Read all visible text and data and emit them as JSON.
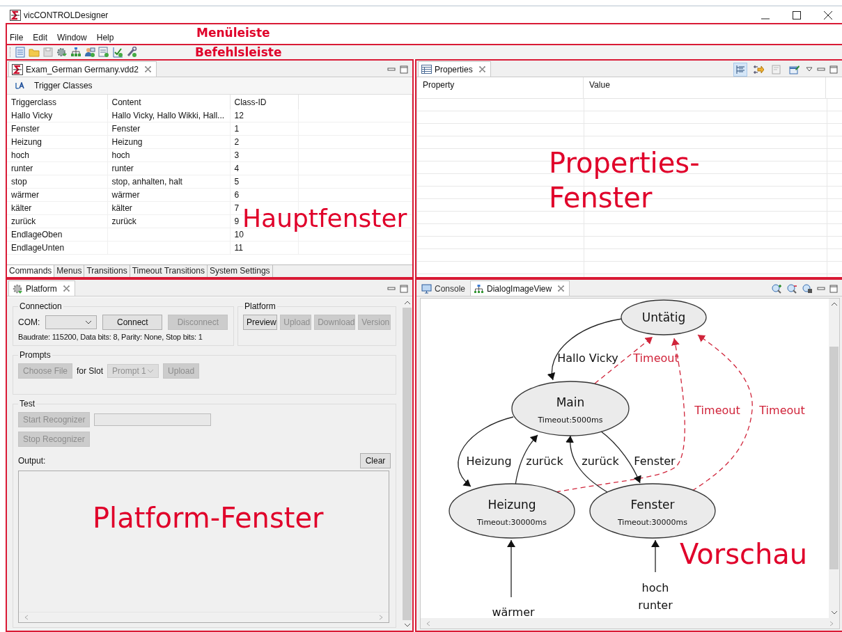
{
  "window": {
    "title": "vicCONTROLDesigner"
  },
  "menu": {
    "items": [
      "File",
      "Edit",
      "Window",
      "Help"
    ],
    "annotation": "Menüleiste"
  },
  "toolbar": {
    "annotation": "Befehlsleiste"
  },
  "editor": {
    "tab": "Exam_German Germany.vdd2",
    "heading": "Trigger Classes",
    "columns": [
      "Triggerclass",
      "Content",
      "Class-ID"
    ],
    "rows": [
      {
        "triggerclass": "Hallo Vicky",
        "content": "Hallo Vicky, Hallo Wikki, Hall...",
        "class_id": "12"
      },
      {
        "triggerclass": "Fenster",
        "content": "Fenster",
        "class_id": "1"
      },
      {
        "triggerclass": "Heizung",
        "content": "Heizung",
        "class_id": "2"
      },
      {
        "triggerclass": "hoch",
        "content": "hoch",
        "class_id": "3"
      },
      {
        "triggerclass": "runter",
        "content": "runter",
        "class_id": "4"
      },
      {
        "triggerclass": "stop",
        "content": "stop, anhalten, halt",
        "class_id": "5"
      },
      {
        "triggerclass": "wärmer",
        "content": "wärmer",
        "class_id": "6"
      },
      {
        "triggerclass": "kälter",
        "content": "kälter",
        "class_id": "7"
      },
      {
        "triggerclass": "zurück",
        "content": "zurück",
        "class_id": "9"
      },
      {
        "triggerclass": "EndlageOben",
        "class_id": "10"
      },
      {
        "triggerclass": "EndlageUnten",
        "class_id": "11"
      }
    ],
    "tabs": [
      {
        "label": "Commands",
        "selected": true
      },
      {
        "label": "Menus",
        "selected": false
      },
      {
        "label": "Transitions",
        "selected": false
      },
      {
        "label": "Timeout Transitions",
        "selected": false
      },
      {
        "label": "System Settings",
        "selected": false
      }
    ],
    "annotation": "Hauptfenster"
  },
  "properties": {
    "tab": "Properties",
    "columns": [
      "Property",
      "Value"
    ],
    "annotation": "Properties-Fenster"
  },
  "platform": {
    "tab": "Platform",
    "connection": {
      "legend": "Connection",
      "com_label": "COM:",
      "buttons": [
        {
          "label": "Connect",
          "disabled": false
        },
        {
          "label": "Disconnect",
          "disabled": true
        }
      ],
      "info": "Baudrate: 115200, Data bits: 8, Parity: None, Stop bits: 1"
    },
    "platform_group": {
      "legend": "Platform",
      "buttons": [
        {
          "label": "Preview",
          "disabled": false
        },
        {
          "label": "Upload",
          "disabled": true
        },
        {
          "label": "Download",
          "disabled": true
        },
        {
          "label": "Version",
          "disabled": true
        }
      ]
    },
    "prompts": {
      "legend": "Prompts",
      "choose": {
        "label": "Choose File",
        "disabled": true
      },
      "for_slot": "for Slot",
      "slot": {
        "value": "Prompt 1",
        "disabled": true
      },
      "upload": {
        "label": "Upload",
        "disabled": true
      }
    },
    "test": {
      "legend": "Test",
      "buttons": [
        {
          "label": "Start Recognizer",
          "disabled": true
        },
        {
          "label": "Stop Recognizer",
          "disabled": true
        }
      ],
      "output_label": "Output:",
      "clear": {
        "label": "Clear",
        "disabled": false
      }
    },
    "annotation": "Platform-Fenster"
  },
  "preview": {
    "tabs": [
      {
        "label": "Console",
        "selected": false
      },
      {
        "label": "DialogImageView",
        "selected": true
      }
    ],
    "nodes": [
      {
        "label": "Untätig"
      },
      {
        "label": "Main",
        "detail": "Timeout:5000ms"
      },
      {
        "label": "Heizung",
        "detail": "Timeout:30000ms"
      },
      {
        "label": "Fenster",
        "detail": "Timeout:30000ms"
      }
    ],
    "edges": [
      {
        "kind": "transition",
        "labels": [
          "Hallo Vicky"
        ]
      },
      {
        "kind": "timeout",
        "labels": [
          "Timeout"
        ]
      },
      {
        "kind": "timeout",
        "labels": [
          "Timeout"
        ]
      },
      {
        "kind": "timeout",
        "labels": [
          "Timeout"
        ]
      },
      {
        "kind": "transition",
        "labels": [
          "Heizung"
        ]
      },
      {
        "kind": "transition",
        "labels": [
          "zurück"
        ]
      },
      {
        "kind": "transition",
        "labels": [
          "zurück"
        ]
      },
      {
        "kind": "transition",
        "labels": [
          "Fenster"
        ]
      },
      {
        "kind": "transition",
        "labels": [
          "wärmer"
        ]
      },
      {
        "kind": "transition",
        "labels": [
          "hoch",
          "runter"
        ]
      }
    ],
    "annotation": "Vorschau"
  }
}
